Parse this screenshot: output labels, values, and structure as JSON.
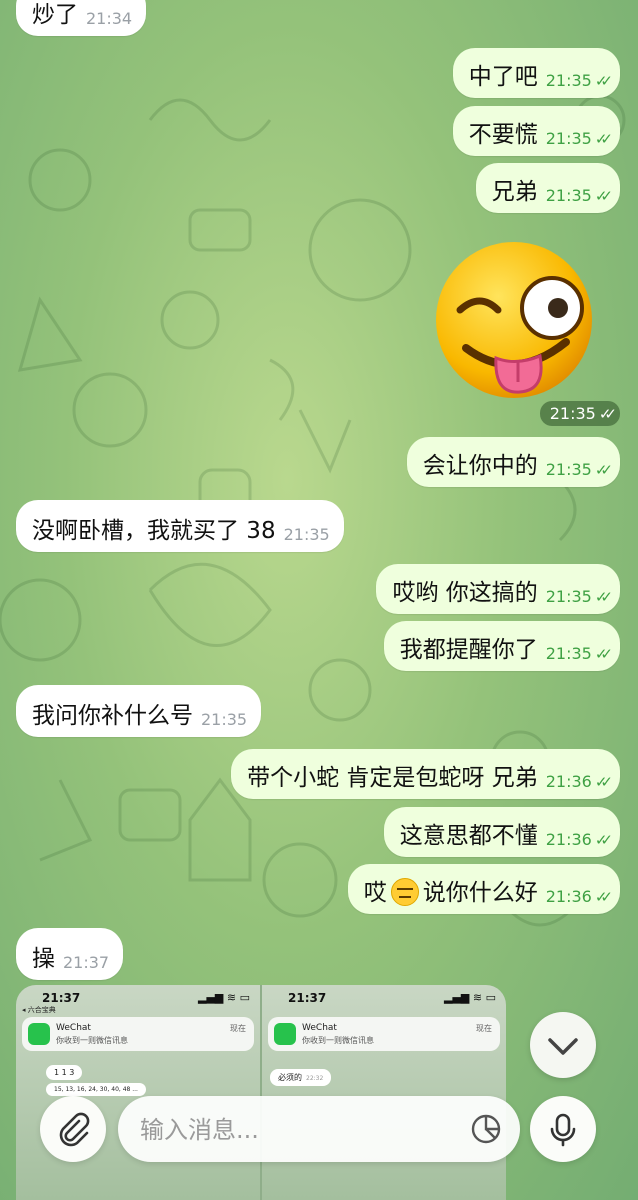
{
  "messages": [
    {
      "dir": "in",
      "text": "炒了",
      "time": "21:34"
    },
    {
      "dir": "out",
      "text": "中了吧",
      "time": "21:35",
      "status": "read"
    },
    {
      "dir": "out",
      "text": "不要慌",
      "time": "21:35",
      "status": "read"
    },
    {
      "dir": "out",
      "text": "兄弟",
      "time": "21:35",
      "status": "read"
    },
    {
      "dir": "out",
      "sticker": "winking-tongue-emoji",
      "time": "21:35",
      "status": "read"
    },
    {
      "dir": "out",
      "text": "会让你中的",
      "time": "21:35",
      "status": "read"
    },
    {
      "dir": "in",
      "text": "没啊卧槽，我就买了 38",
      "time": "21:35"
    },
    {
      "dir": "out",
      "text": "哎哟 你这搞的",
      "time": "21:35",
      "status": "read"
    },
    {
      "dir": "out",
      "text": "我都提醒你了",
      "time": "21:35",
      "status": "read"
    },
    {
      "dir": "in",
      "text": "我问你补什么号",
      "time": "21:35"
    },
    {
      "dir": "out",
      "text": "带个小蛇 肯定是包蛇呀 兄弟",
      "time": "21:36",
      "status": "read"
    },
    {
      "dir": "out",
      "text": "这意思都不懂",
      "time": "21:36",
      "status": "read"
    },
    {
      "dir": "out",
      "text_before": "哎",
      "emoji": "expressionless-face",
      "text_after": "说你什么好",
      "time": "21:36",
      "status": "read"
    },
    {
      "dir": "in",
      "text": "操",
      "time": "21:37"
    }
  ],
  "ticks": "✓✓",
  "screenshot_attachment": {
    "left": {
      "time": "21:37",
      "app": "WeChat",
      "body": "你收到一则微信讯息",
      "sub": "◂ 六合宝典",
      "tag": "现在",
      "numbers": "1 1 3",
      "row": "15, 13, 16, 24, 30, 40, 48 ..."
    },
    "right": {
      "time": "21:37",
      "app": "WeChat",
      "body": "你收到一则微信讯息",
      "tag": "现在",
      "bubble": "必须的",
      "bubble_time": "22:32"
    }
  },
  "input": {
    "placeholder": "输入消息..."
  },
  "colors": {
    "accent": "#3fa144",
    "outgoing_bubble": "#efffdd",
    "incoming_bubble": "#ffffff"
  }
}
